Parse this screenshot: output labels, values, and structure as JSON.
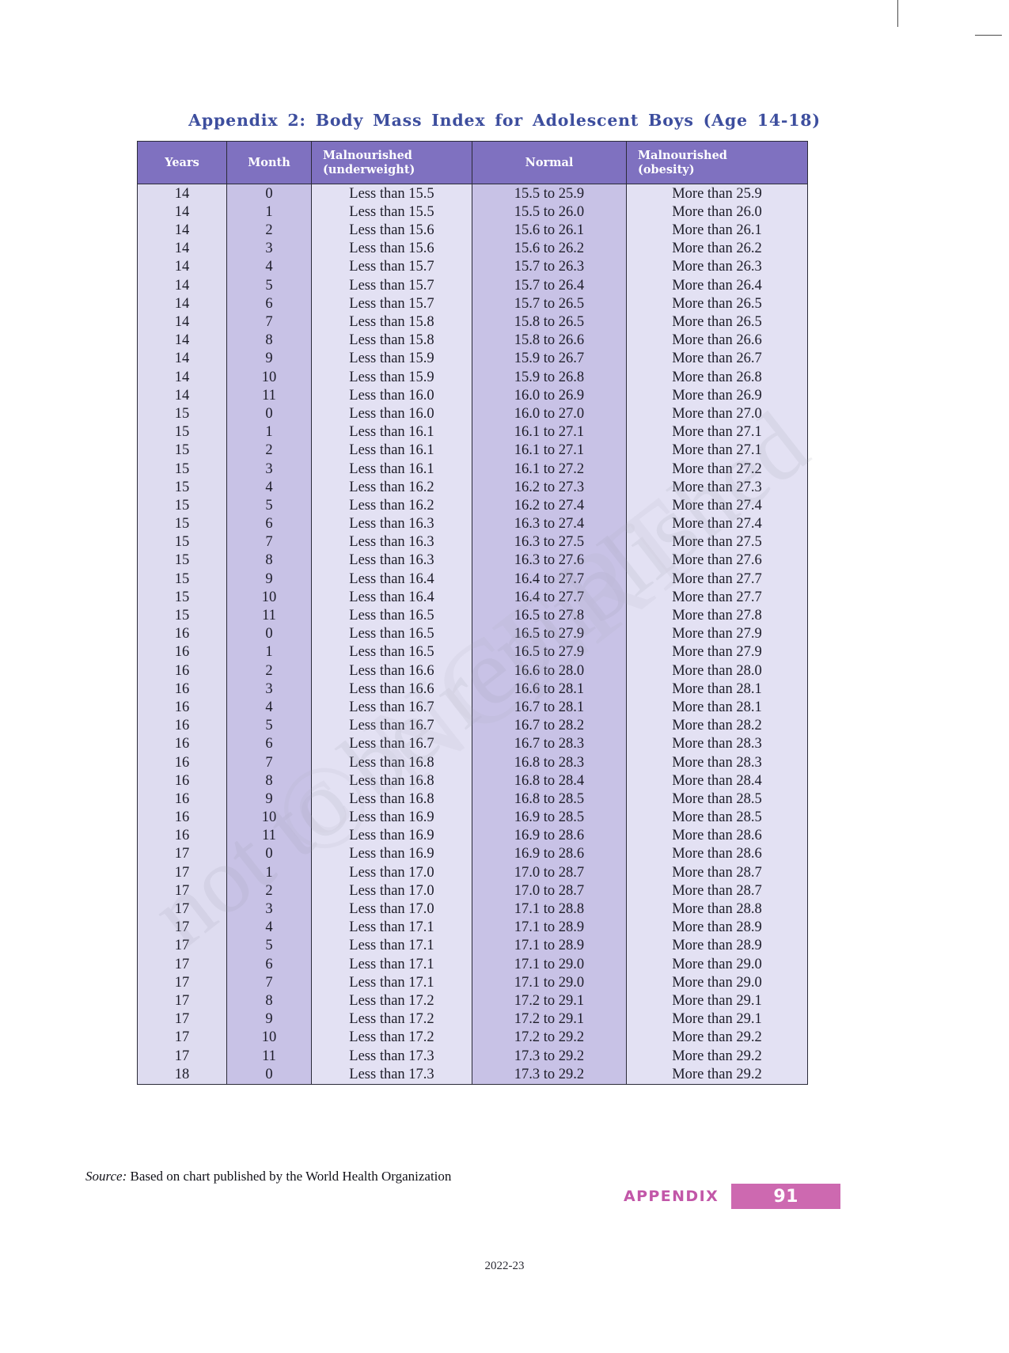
{
  "document": {
    "title": "Appendix 2: Body Mass Index for Adolescent Boys (Age 14-18)",
    "source_label": "Source:",
    "source_text": "Based on chart published by the World Health Organization",
    "footer_section": "Appendix",
    "page_number": "91",
    "year_stamp": "2022-23",
    "watermark_text": "not to be republished",
    "colors": {
      "title": "#3d4e9e",
      "header_bg": "#7f71c0",
      "row_shade_light": "#e3e1f3",
      "row_shade_dark": "#c8c2e6",
      "badge": "#cd69b0",
      "appendix_word": "#c257a8"
    }
  },
  "table": {
    "columns": [
      "Years",
      "Month",
      "Malnourished (underweight)",
      "Normal",
      "Malnourished (obesity)"
    ],
    "headers": {
      "years": "Years",
      "month": "Month",
      "underweight_line1": "Malnourished",
      "underweight_line2": "(underweight)",
      "normal": "Normal",
      "obesity_line1": "Malnourished",
      "obesity_line2": "(obesity)"
    },
    "rows": [
      [
        "14",
        "0",
        "Less than 15.5",
        "15.5 to 25.9",
        "More than 25.9"
      ],
      [
        "14",
        "1",
        "Less than 15.5",
        "15.5 to 26.0",
        "More than 26.0"
      ],
      [
        "14",
        "2",
        "Less than 15.6",
        "15.6 to 26.1",
        "More than 26.1"
      ],
      [
        "14",
        "3",
        "Less than 15.6",
        "15.6 to 26.2",
        "More than 26.2"
      ],
      [
        "14",
        "4",
        "Less than 15.7",
        "15.7 to 26.3",
        "More than 26.3"
      ],
      [
        "14",
        "5",
        "Less than 15.7",
        "15.7 to 26.4",
        "More than 26.4"
      ],
      [
        "14",
        "6",
        "Less than 15.7",
        "15.7 to 26.5",
        "More than 26.5"
      ],
      [
        "14",
        "7",
        "Less than 15.8",
        "15.8 to 26.5",
        "More than 26.5"
      ],
      [
        "14",
        "8",
        "Less than 15.8",
        "15.8 to 26.6",
        "More than 26.6"
      ],
      [
        "14",
        "9",
        "Less than 15.9",
        "15.9 to 26.7",
        "More than 26.7"
      ],
      [
        "14",
        "10",
        "Less than 15.9",
        "15.9 to 26.8",
        "More than 26.8"
      ],
      [
        "14",
        "11",
        "Less than 16.0",
        "16.0 to 26.9",
        "More than 26.9"
      ],
      [
        "15",
        "0",
        "Less than 16.0",
        "16.0 to 27.0",
        "More than 27.0"
      ],
      [
        "15",
        "1",
        "Less than 16.1",
        "16.1 to 27.1",
        "More than 27.1"
      ],
      [
        "15",
        "2",
        "Less than 16.1",
        "16.1 to 27.1",
        "More than 27.1"
      ],
      [
        "15",
        "3",
        "Less than 16.1",
        "16.1 to 27.2",
        "More than 27.2"
      ],
      [
        "15",
        "4",
        "Less than 16.2",
        "16.2 to 27.3",
        "More than 27.3"
      ],
      [
        "15",
        "5",
        "Less than 16.2",
        "16.2 to 27.4",
        "More than 27.4"
      ],
      [
        "15",
        "6",
        "Less than 16.3",
        "16.3 to 27.4",
        "More than 27.4"
      ],
      [
        "15",
        "7",
        "Less than 16.3",
        "16.3 to 27.5",
        "More than 27.5"
      ],
      [
        "15",
        "8",
        "Less than 16.3",
        "16.3 to 27.6",
        "More than 27.6"
      ],
      [
        "15",
        "9",
        "Less than 16.4",
        "16.4 to 27.7",
        "More than 27.7"
      ],
      [
        "15",
        "10",
        "Less than 16.4",
        "16.4 to 27.7",
        "More than 27.7"
      ],
      [
        "15",
        "11",
        "Less than 16.5",
        "16.5 to 27.8",
        "More than 27.8"
      ],
      [
        "16",
        "0",
        "Less than 16.5",
        "16.5 to 27.9",
        "More than 27.9"
      ],
      [
        "16",
        "1",
        "Less than 16.5",
        "16.5 to 27.9",
        "More than 27.9"
      ],
      [
        "16",
        "2",
        "Less than 16.6",
        "16.6 to 28.0",
        "More than 28.0"
      ],
      [
        "16",
        "3",
        "Less than 16.6",
        "16.6 to 28.1",
        "More than 28.1"
      ],
      [
        "16",
        "4",
        "Less than 16.7",
        "16.7 to 28.1",
        "More than 28.1"
      ],
      [
        "16",
        "5",
        "Less than 16.7",
        "16.7 to 28.2",
        "More than 28.2"
      ],
      [
        "16",
        "6",
        "Less than 16.7",
        "16.7 to 28.3",
        "More than 28.3"
      ],
      [
        "16",
        "7",
        "Less than 16.8",
        "16.8 to 28.3",
        "More than 28.3"
      ],
      [
        "16",
        "8",
        "Less than 16.8",
        "16.8 to 28.4",
        "More than 28.4"
      ],
      [
        "16",
        "9",
        "Less than 16.8",
        "16.8 to 28.5",
        "More than 28.5"
      ],
      [
        "16",
        "10",
        "Less than 16.9",
        "16.9 to 28.5",
        "More than 28.5"
      ],
      [
        "16",
        "11",
        "Less than 16.9",
        "16.9 to 28.6",
        "More than 28.6"
      ],
      [
        "17",
        "0",
        "Less than 16.9",
        "16.9 to 28.6",
        "More than 28.6"
      ],
      [
        "17",
        "1",
        "Less than 17.0",
        "17.0 to 28.7",
        "More than 28.7"
      ],
      [
        "17",
        "2",
        "Less than 17.0",
        "17.0 to 28.7",
        "More than 28.7"
      ],
      [
        "17",
        "3",
        "Less than 17.0",
        "17.1 to 28.8",
        "More than 28.8"
      ],
      [
        "17",
        "4",
        "Less than 17.1",
        "17.1 to 28.9",
        "More than 28.9"
      ],
      [
        "17",
        "5",
        "Less than 17.1",
        "17.1 to 28.9",
        "More than 28.9"
      ],
      [
        "17",
        "6",
        "Less than 17.1",
        "17.1 to 29.0",
        "More than 29.0"
      ],
      [
        "17",
        "7",
        "Less than 17.1",
        "17.1 to 29.0",
        "More than 29.0"
      ],
      [
        "17",
        "8",
        "Less than 17.2",
        "17.2 to 29.1",
        "More than 29.1"
      ],
      [
        "17",
        "9",
        "Less than 17.2",
        "17.2 to 29.1",
        "More than 29.1"
      ],
      [
        "17",
        "10",
        "Less than 17.2",
        "17.2 to 29.2",
        "More than 29.2"
      ],
      [
        "17",
        "11",
        "Less than 17.3",
        "17.3 to 29.2",
        "More than 29.2"
      ],
      [
        "18",
        "0",
        "Less than 17.3",
        "17.3 to 29.2",
        "More than 29.2"
      ]
    ]
  }
}
